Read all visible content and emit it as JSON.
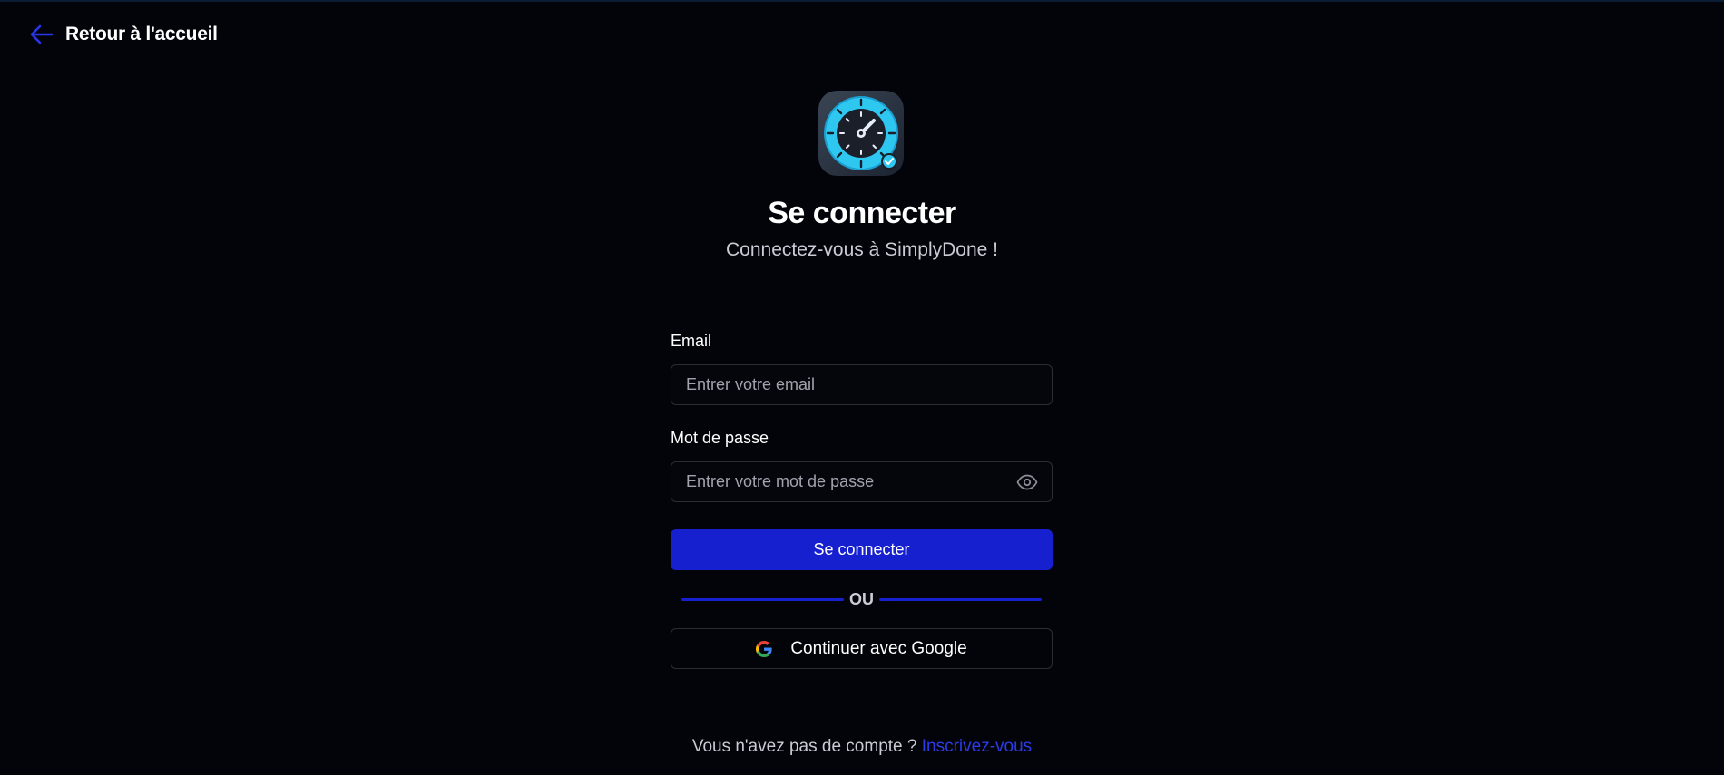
{
  "nav": {
    "back_label": "Retour à l'accueil",
    "back_icon": "arrow-left-icon"
  },
  "brand": {
    "logo_icon": "stopwatch-check-icon"
  },
  "header": {
    "title": "Se connecter",
    "subtitle": "Connectez-vous à SimplyDone !"
  },
  "form": {
    "email": {
      "label": "Email",
      "placeholder": "Entrer votre email",
      "value": ""
    },
    "password": {
      "label": "Mot de passe",
      "placeholder": "Entrer votre mot de passe",
      "value": "",
      "toggle_icon": "eye-icon"
    },
    "submit_label": "Se connecter",
    "divider_text": "OU",
    "google_label": "Continuer avec Google",
    "google_icon": "google-icon"
  },
  "footer": {
    "prompt": "Vous n'avez pas de compte ?",
    "signup_link": "Inscrivez-vous"
  },
  "colors": {
    "background": "#03040a",
    "accent": "#1620cf",
    "link": "#2b3be6",
    "logo_cyan": "#2ec7f0"
  }
}
